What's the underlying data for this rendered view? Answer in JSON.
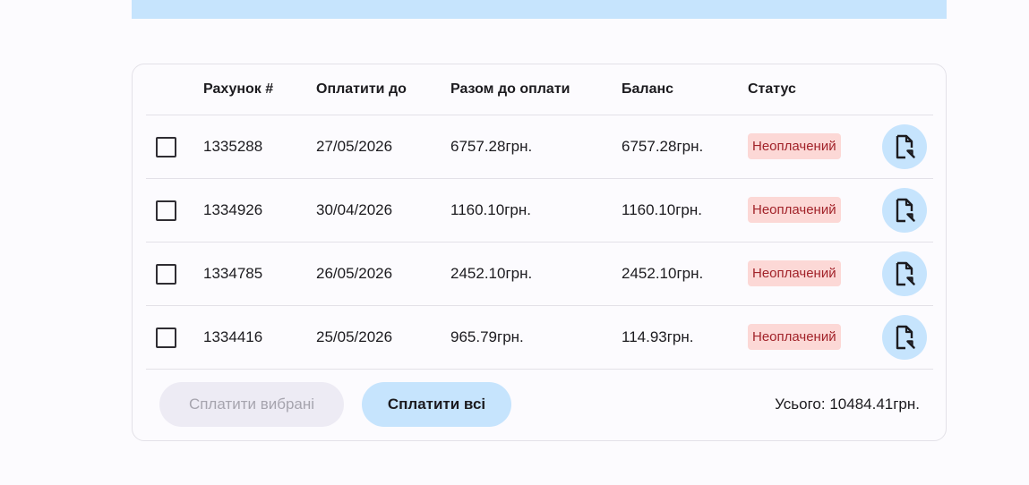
{
  "table": {
    "headers": {
      "number": "Рахунок #",
      "due": "Оплатити до",
      "total": "Разом до оплати",
      "balance": "Баланс",
      "status": "Статус"
    },
    "rows": [
      {
        "number": "1335288",
        "due": "27/05/2026",
        "total": "6757.28грн.",
        "balance": "6757.28грн.",
        "status": "Неоплачений",
        "checked": false
      },
      {
        "number": "1334926",
        "due": "30/04/2026",
        "total": "1160.10грн.",
        "balance": "1160.10грн.",
        "status": "Неоплачений",
        "checked": false
      },
      {
        "number": "1334785",
        "due": "26/05/2026",
        "total": "2452.10грн.",
        "balance": "2452.10грн.",
        "status": "Неоплачений",
        "checked": false
      },
      {
        "number": "1334416",
        "due": "25/05/2026",
        "total": "965.79грн.",
        "balance": "114.93грн.",
        "status": "Неоплачений",
        "checked": false
      }
    ],
    "row_action_icon": "document-open-icon"
  },
  "footer": {
    "pay_selected_label": "Сплатити вибрані",
    "pay_selected_disabled": true,
    "pay_all_label": "Сплатити всі",
    "total_text": "Усього: 10484.41грн."
  },
  "colors": {
    "accent": "#c6e4fd",
    "status_unpaid_bg": "#fcd8d6",
    "status_unpaid_text": "#a2232a",
    "disabled_bg": "#edebf4",
    "disabled_text": "#a6a4ae"
  }
}
